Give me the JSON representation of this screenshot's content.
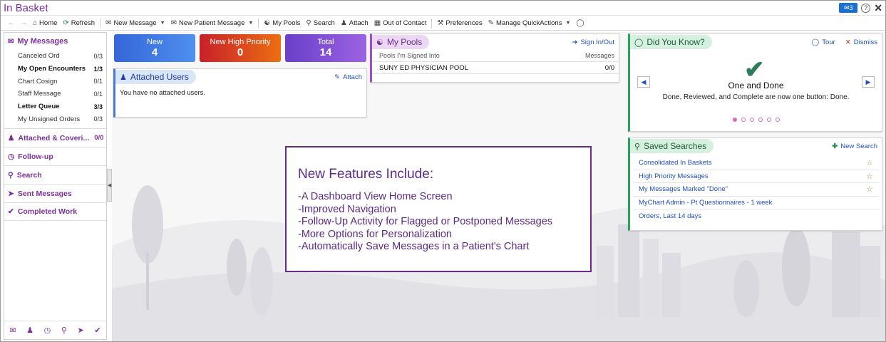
{
  "app": {
    "title": "In Basket"
  },
  "titlebar": {
    "badge": "3"
  },
  "toolbar": {
    "home": "Home",
    "refresh": "Refresh",
    "new_message": "New Message",
    "new_patient_message": "New Patient Message",
    "my_pools": "My Pools",
    "search": "Search",
    "attach": "Attach",
    "out_of_contact": "Out of Contact",
    "preferences": "Preferences",
    "manage_quickactions": "Manage QuickActions"
  },
  "sidebar": {
    "my_messages": "My Messages",
    "items": [
      {
        "label": "Canceled Ord",
        "count": "0/3",
        "bold": false
      },
      {
        "label": "My Open Encounters",
        "count": "1/3",
        "bold": true
      },
      {
        "label": "Chart Cosign",
        "count": "0/1",
        "bold": false
      },
      {
        "label": "Staff Message",
        "count": "0/1",
        "bold": false
      },
      {
        "label": "Letter Queue",
        "count": "3/3",
        "bold": true
      },
      {
        "label": "My Unsigned Orders",
        "count": "0/3",
        "bold": false
      }
    ],
    "attached_covering": "Attached & Coveri...",
    "attached_covering_count": "0/0",
    "follow_up": "Follow-up",
    "search": "Search",
    "sent_messages": "Sent Messages",
    "completed_work": "Completed Work"
  },
  "tiles": {
    "new": {
      "label": "New",
      "value": "4"
    },
    "high": {
      "label": "New High Priority",
      "value": "0"
    },
    "total": {
      "label": "Total",
      "value": "14"
    }
  },
  "attached_users": {
    "title": "Attached Users",
    "attach": "Attach",
    "empty": "You have no attached users."
  },
  "my_pools": {
    "title": "My Pools",
    "sign_in_out": "Sign In/Out",
    "col_pools": "Pools I'm Signed Into",
    "col_messages": "Messages",
    "rows": [
      {
        "name": "SUNY ED PHYSICIAN POOL",
        "messages": "0/0"
      }
    ]
  },
  "did_you_know": {
    "title": "Did You Know?",
    "tour": "Tour",
    "dismiss": "Dismiss",
    "headline": "One and Done",
    "description": "Done, Reviewed, and Complete are now one button: Done."
  },
  "saved_searches": {
    "title": "Saved Searches",
    "new_search": "New Search",
    "rows": [
      {
        "label": "Consolidated In Baskets",
        "starred": true
      },
      {
        "label": "High Priority Messages",
        "starred": true
      },
      {
        "label": "My Messages Marked \"Done\"",
        "starred": true
      },
      {
        "label": "MyChart Admin - Pt Questionnaires - 1 week",
        "starred": false
      },
      {
        "label": "Orders, Last 14 days",
        "starred": false
      }
    ]
  },
  "callout": {
    "heading": "New Features Include:",
    "lines": [
      "-A Dashboard View Home Screen",
      "-Improved Navigation",
      "-Follow-Up Activity for Flagged or Postponed Messages",
      "-More Options for Personalization",
      "-Automatically Save Messages in a Patient's Chart"
    ]
  }
}
